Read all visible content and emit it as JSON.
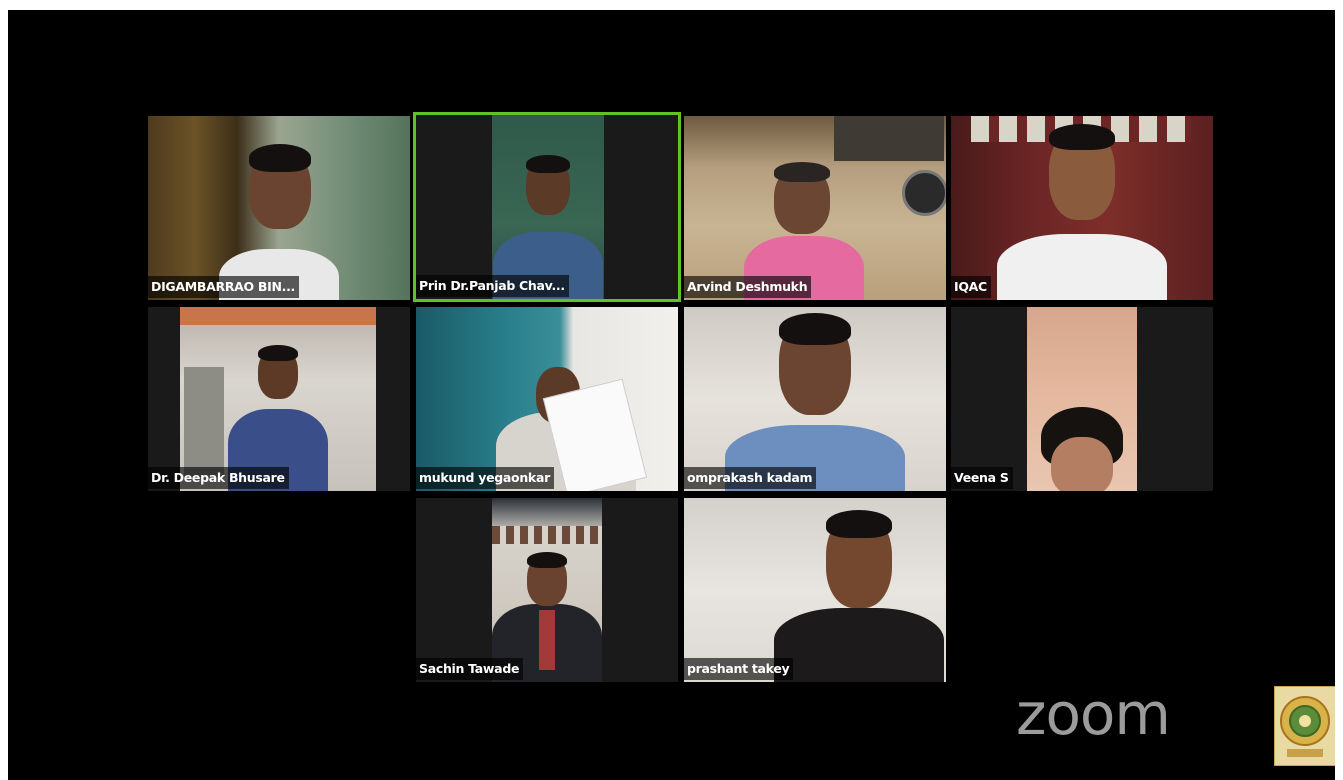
{
  "app": {
    "brand_text": "zoom",
    "active_speaker_color": "#5fc326"
  },
  "participants": [
    {
      "name": "DIGAMBARRAO BIN..."
    },
    {
      "name": "Prin Dr.Panjab Chav..."
    },
    {
      "name": "Arvind Deshmukh"
    },
    {
      "name": "IQAC"
    },
    {
      "name": "Dr. Deepak Bhusare"
    },
    {
      "name": "mukund yegaonkar"
    },
    {
      "name": "omprakash kadam"
    },
    {
      "name": "Veena S"
    },
    {
      "name": "Sachin Tawade"
    },
    {
      "name": "prashant takey"
    }
  ],
  "icons": {
    "seal": "institution-seal-icon"
  }
}
